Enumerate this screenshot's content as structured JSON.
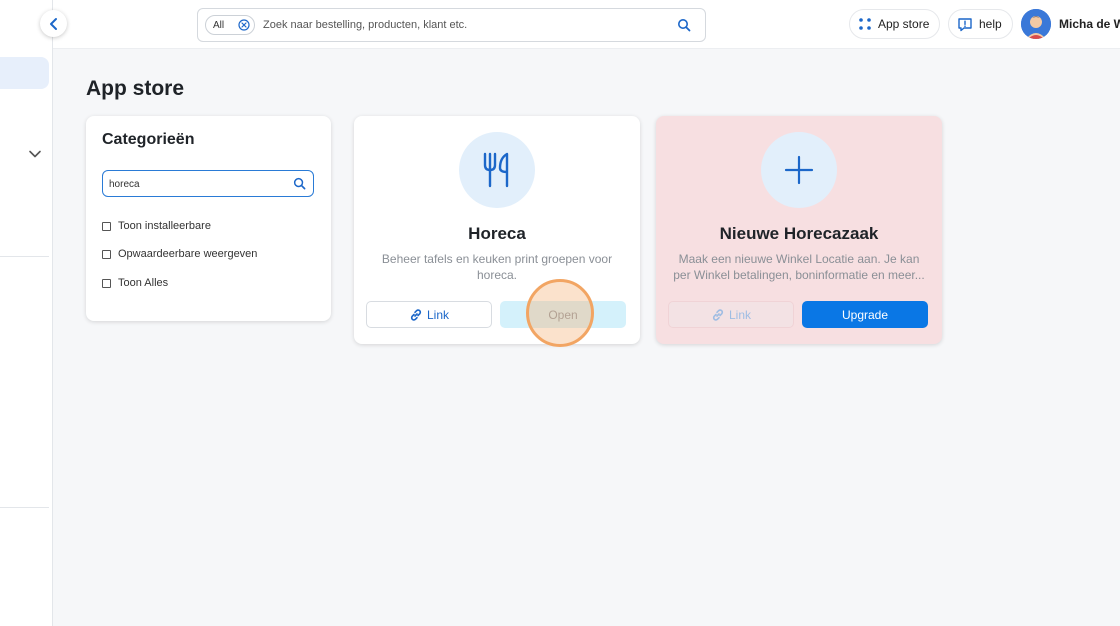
{
  "topbar": {
    "search_scope": "All",
    "search_placeholder": "Zoek naar bestelling, producten, klant etc.",
    "app_store_label": "App store",
    "help_label": "help",
    "user_name": "Micha de Wa"
  },
  "page": {
    "title": "App store"
  },
  "categories": {
    "title": "Categorieën",
    "search_value": "horeca",
    "filters": [
      {
        "label": "Toon installeerbare",
        "checked": false
      },
      {
        "label": "Opwaardeerbare weergeven",
        "checked": false
      },
      {
        "label": "Toon Alles",
        "checked": false
      }
    ]
  },
  "apps": [
    {
      "title": "Horeca",
      "description": "Beheer tafels en keuken print groepen voor horeca.",
      "link_label": "Link",
      "action_label": "Open",
      "icon": "fork-knife-icon"
    },
    {
      "title": "Nieuwe Horecazaak",
      "description": "Maak een nieuwe Winkel Locatie aan. Je kan per Winkel betalingen, boninformatie en meer...",
      "link_label": "Link",
      "action_label": "Upgrade",
      "icon": "plus-icon"
    }
  ],
  "colors": {
    "accent": "#0a77e5",
    "upgrade_card_bg": "#f7dfe1",
    "icon_circle_bg": "#e2effb"
  }
}
